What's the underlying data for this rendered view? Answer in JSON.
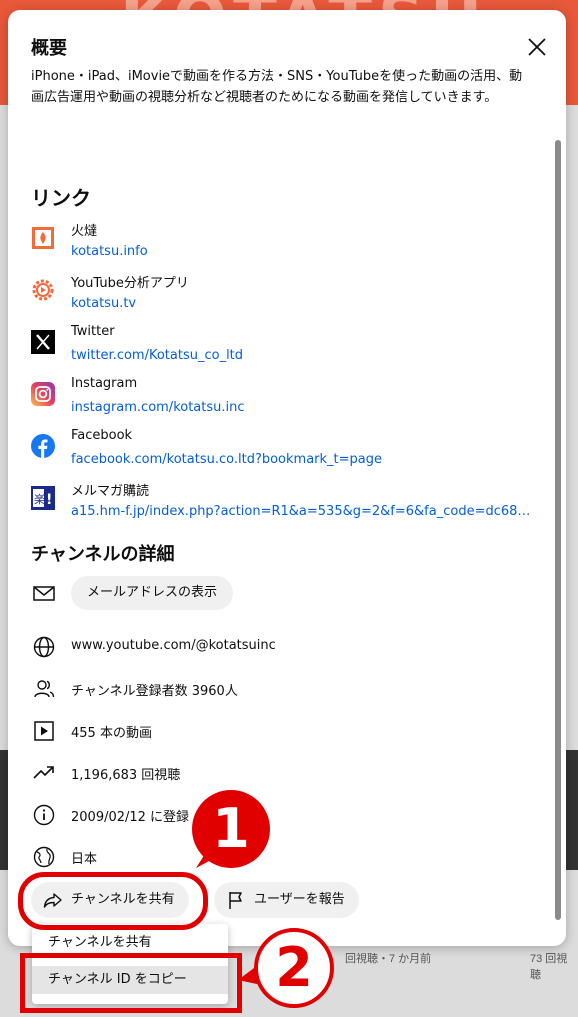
{
  "dialog": {
    "title": "概要",
    "description": "iPhone・iPad、iMovieで動画を作る方法・SNS・YouTubeを使った動画の活用、動画広告運用や動画の視聴分析など視聴者のためになる動画を発信していきます。",
    "links_heading": "リンク",
    "links": [
      {
        "name": "火燵",
        "url": "kotatsu.info",
        "icon": "kotatsu-icon"
      },
      {
        "name": "YouTube分析アプリ",
        "url": "kotatsu.tv",
        "icon": "gear-icon"
      },
      {
        "name": "Twitter",
        "url": "twitter.com/Kotatsu_co_ltd",
        "icon": "x-twitter-icon"
      },
      {
        "name": "Instagram",
        "url": "instagram.com/kotatsu.inc",
        "icon": "instagram-icon"
      },
      {
        "name": "Facebook",
        "url": "facebook.com/kotatsu.co.ltd?bookmark_t=page",
        "icon": "facebook-icon"
      },
      {
        "name": "メルマガ購読",
        "url": "a15.hm-f.jp/index.php?action=R1&a=535&g=2&f=6&fa_code=dc68084d...",
        "icon": "rakuten-icon"
      }
    ],
    "details_heading": "チャンネルの詳細",
    "details": {
      "email_button": "メールアドレスの表示",
      "url": "www.youtube.com/@kotatsuinc",
      "subscribers": "チャンネル登録者数 3960人",
      "videos": "455 本の動画",
      "views": "1,196,683 回視聴",
      "joined": "2009/02/12 に登録",
      "country": "日本"
    },
    "share_button": "チャンネルを共有",
    "report_button": "ユーザーを報告"
  },
  "share_menu": {
    "items": [
      "チャンネルを共有",
      "チャンネル ID をコピー"
    ]
  },
  "background": {
    "meta_left": "回視聴・7 か月前",
    "meta_right": "73 回視聴"
  },
  "annotations": {
    "badge1": "1",
    "badge2": "2",
    "color": "#e00000"
  }
}
